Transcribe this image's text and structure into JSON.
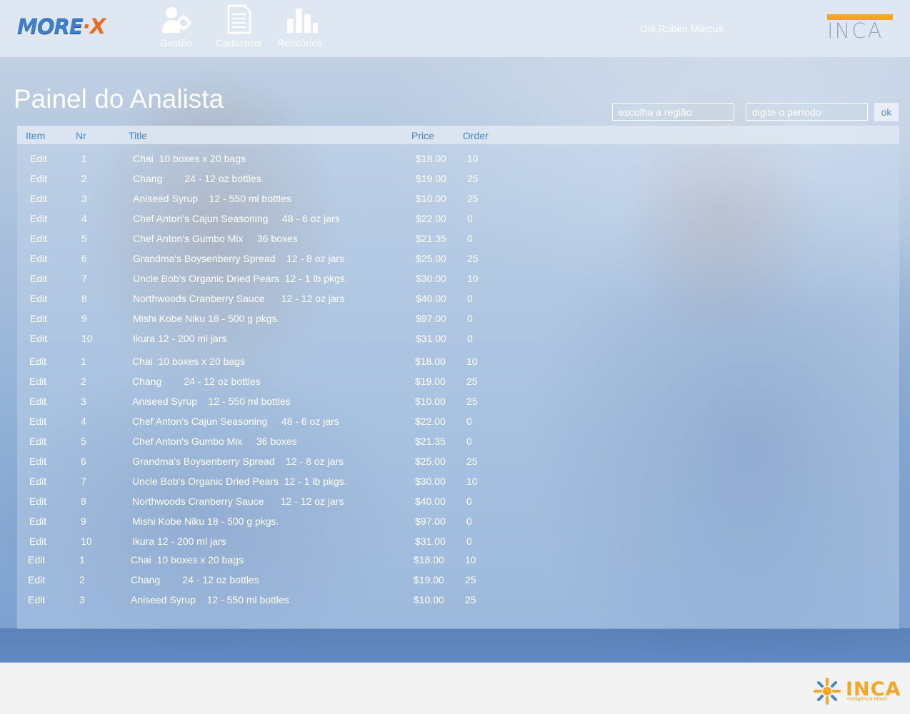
{
  "brand": {
    "logo_left": "MORE",
    "logo_right": "X",
    "logo_sep": "·",
    "partner": "INCA"
  },
  "nav": [
    {
      "label": "Gestão",
      "icon": "user-gear-icon"
    },
    {
      "label": "Cadastros",
      "icon": "document-list-icon"
    },
    {
      "label": "Relatórios",
      "icon": "bar-chart-icon"
    }
  ],
  "user": {
    "greeting": "Olá,Ruben Marcus"
  },
  "page": {
    "title": "Painel do Analista"
  },
  "filters": {
    "region_placeholder": "escolha a região",
    "period_placeholder": "digite o período",
    "ok_label": "ok"
  },
  "table": {
    "headers": [
      "Item",
      "Nr",
      "Title",
      "Price",
      "Order"
    ],
    "rows": [
      {
        "item": "Edit",
        "nr": "1",
        "title": "Chai  10 boxes x 20 bags",
        "price": "$18.00",
        "order": "10"
      },
      {
        "item": "Edit",
        "nr": "2",
        "title": "Chang        24 - 12 oz bottles",
        "price": "$19.00",
        "order": "25"
      },
      {
        "item": "Edit",
        "nr": "3",
        "title": "Aniseed Syrup    12 - 550 ml bottles",
        "price": "$10.00",
        "order": "25"
      },
      {
        "item": "Edit",
        "nr": "4",
        "title": "Chef Anton's Cajun Seasoning     48 - 6 oz jars",
        "price": "$22.00",
        "order": "0"
      },
      {
        "item": "Edit",
        "nr": "5",
        "title": "Chef Anton's Gumbo Mix     36 boxes",
        "price": "$21.35",
        "order": "0"
      },
      {
        "item": "Edit",
        "nr": "6",
        "title": "Grandma's Boysenberry Spread    12 - 8 oz jars",
        "price": "$25.00",
        "order": "25"
      },
      {
        "item": "Edit",
        "nr": "7",
        "title": "Uncle Bob's Organic Dried Pears  12 - 1 lb pkgs.",
        "price": "$30.00",
        "order": "10"
      },
      {
        "item": "Edit",
        "nr": "8",
        "title": "Northwoods Cranberry Sauce      12 - 12 oz jars",
        "price": "$40.00",
        "order": "0"
      },
      {
        "item": "Edit",
        "nr": "9",
        "title": "Mishi Kobe Niku 18 - 500 g pkgs.",
        "price": "$97.00",
        "order": "0"
      },
      {
        "item": "Edit",
        "nr": "10",
        "title": "Ikura 12 - 200 ml jars",
        "price": "$31.00",
        "order": "0"
      },
      {
        "item": "Edit",
        "nr": "1",
        "title": "Chai  10 boxes x 20 bags",
        "price": "$18.00",
        "order": "10"
      },
      {
        "item": "Edit",
        "nr": "2",
        "title": "Chang        24 - 12 oz bottles",
        "price": "$19.00",
        "order": "25"
      },
      {
        "item": "Edit",
        "nr": "3",
        "title": "Aniseed Syrup    12 - 550 ml bottles",
        "price": "$10.00",
        "order": "25"
      },
      {
        "item": "Edit",
        "nr": "4",
        "title": "Chef Anton's Cajun Seasoning     48 - 6 oz jars",
        "price": "$22.00",
        "order": "0"
      },
      {
        "item": "Edit",
        "nr": "5",
        "title": "Chef Anton's Gumbo Mix     36 boxes",
        "price": "$21.35",
        "order": "0"
      },
      {
        "item": "Edit",
        "nr": "6",
        "title": "Grandma's Boysenberry Spread    12 - 8 oz jars",
        "price": "$25.00",
        "order": "25"
      },
      {
        "item": "Edit",
        "nr": "7",
        "title": "Uncle Bob's Organic Dried Pears  12 - 1 lb pkgs.",
        "price": "$30.00",
        "order": "10"
      },
      {
        "item": "Edit",
        "nr": "8",
        "title": "Northwoods Cranberry Sauce      12 - 12 oz jars",
        "price": "$40.00",
        "order": "0"
      },
      {
        "item": "Edit",
        "nr": "9",
        "title": "Mishi Kobe Niku 18 - 500 g pkgs.",
        "price": "$97.00",
        "order": "0"
      },
      {
        "item": "Edit",
        "nr": "10",
        "title": "Ikura 12 - 200 ml jars",
        "price": "$31.00",
        "order": "0"
      },
      {
        "item": "Edit",
        "nr": "1",
        "title": "Chai  10 boxes x 20 bags",
        "price": "$18.00",
        "order": "10"
      },
      {
        "item": "Edit",
        "nr": "2",
        "title": "Chang        24 - 12 oz bottles",
        "price": "$19.00",
        "order": "25"
      },
      {
        "item": "Edit",
        "nr": "3",
        "title": "Aniseed Syrup    12 - 550 ml bottles",
        "price": "$10.00",
        "order": "25"
      }
    ]
  },
  "footer": {
    "brand": "INCA",
    "tagline": "Inteligência Móvel"
  },
  "colors": {
    "accent": "#f5a623",
    "header_text": "#4a84c4",
    "logo_blue": "#3f7fc8",
    "logo_orange": "#f06a1a"
  }
}
